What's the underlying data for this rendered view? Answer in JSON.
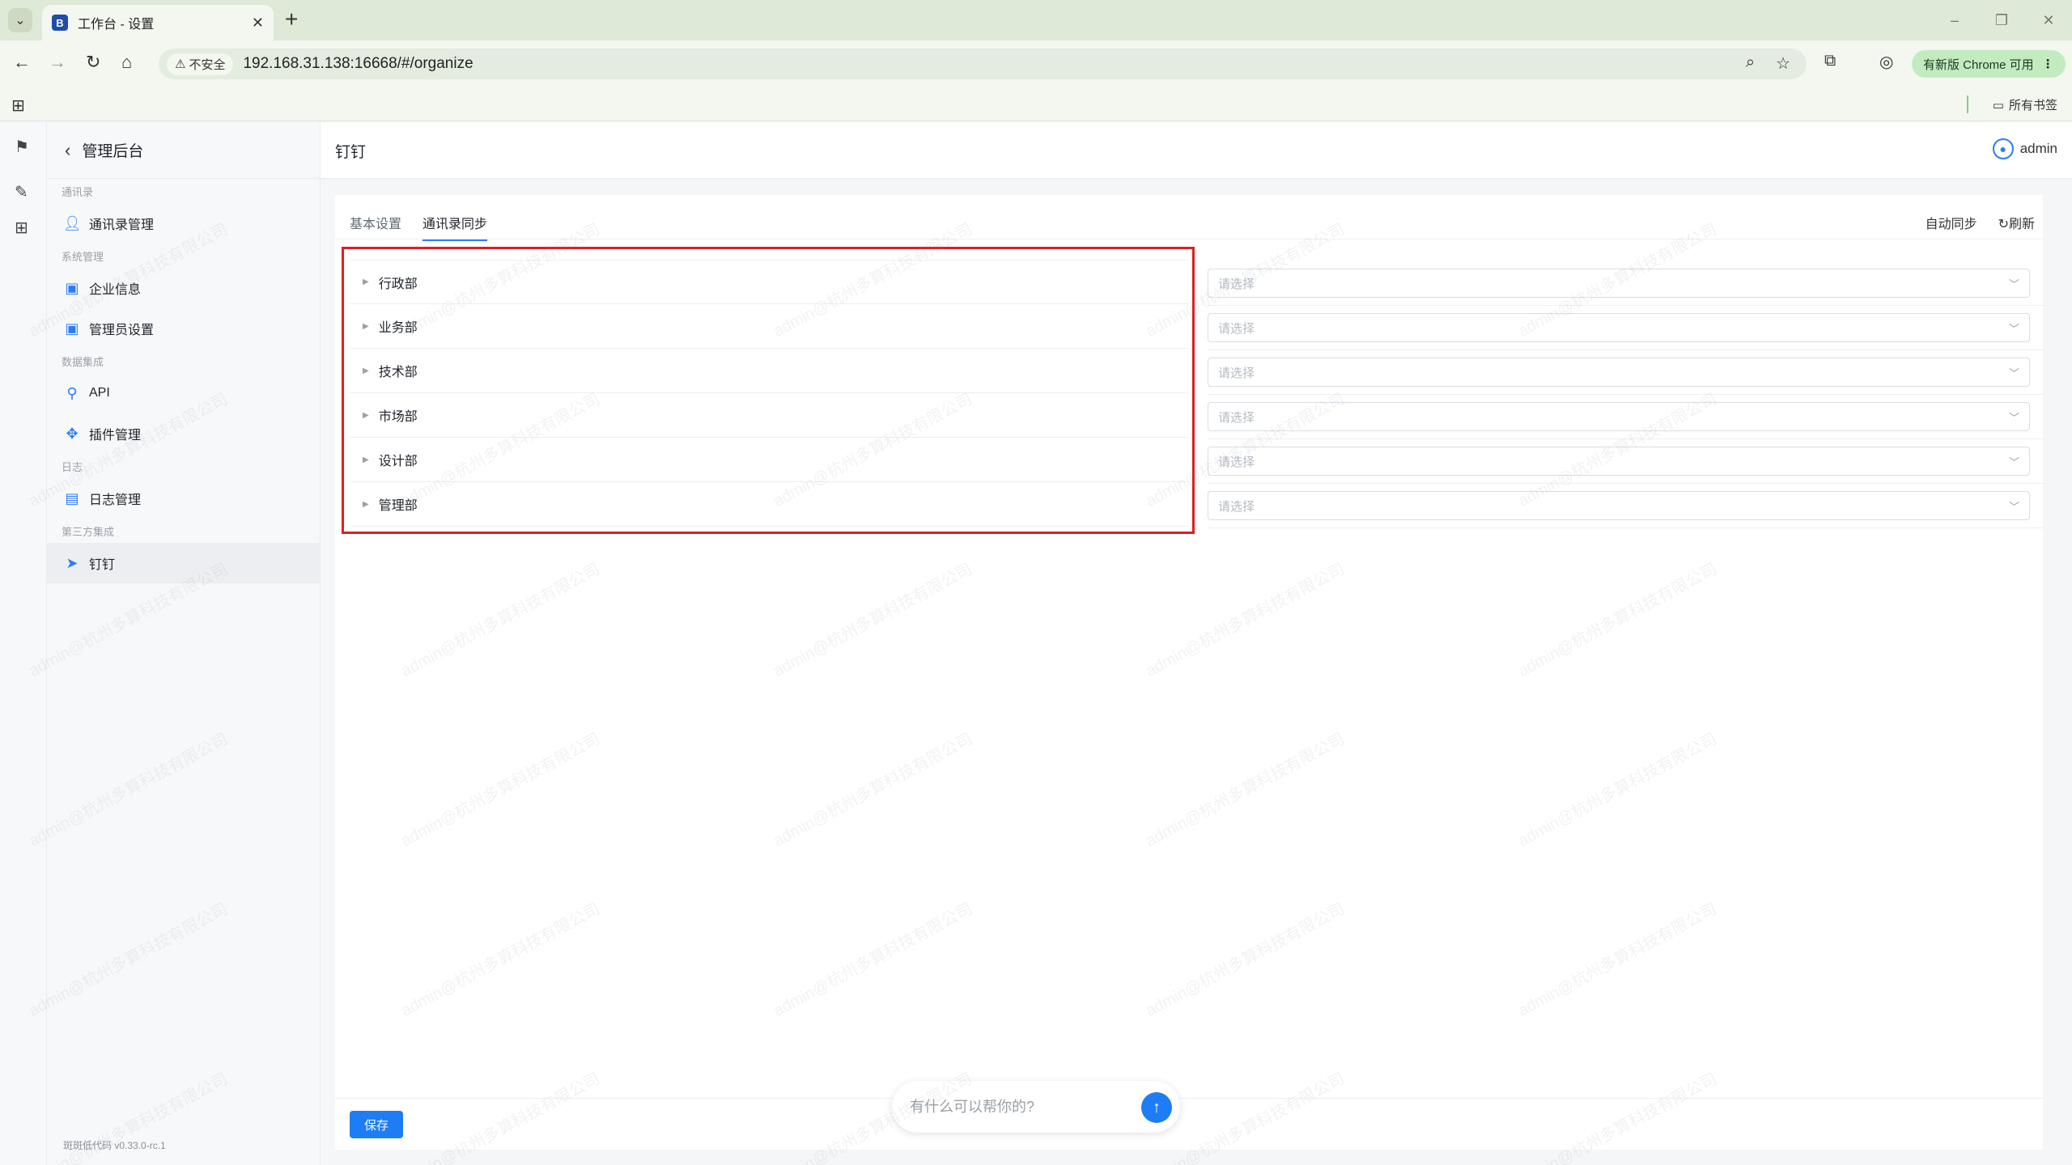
{
  "browser": {
    "tab_title": "工作台 - 设置",
    "insecure_label": "不安全",
    "url": "192.168.31.138:16668/#/organize",
    "update_label": "有新版 Chrome 可用",
    "all_bookmarks": "所有书签"
  },
  "sidebar": {
    "title": "管理后台",
    "groups": [
      {
        "label": "通讯录",
        "items": [
          {
            "label": "通讯录管理"
          }
        ]
      },
      {
        "label": "系统管理",
        "items": [
          {
            "label": "企业信息"
          },
          {
            "label": "管理员设置"
          }
        ]
      },
      {
        "label": "数据集成",
        "items": [
          {
            "label": "API"
          },
          {
            "label": "插件管理"
          }
        ]
      },
      {
        "label": "日志",
        "items": [
          {
            "label": "日志管理"
          }
        ]
      },
      {
        "label": "第三方集成",
        "items": [
          {
            "label": "钉钉"
          }
        ]
      }
    ],
    "version": "斑斑低代码 v0.33.0-rc.1"
  },
  "header": {
    "title": "钉钉",
    "user": "admin"
  },
  "tabs": [
    {
      "label": "基本设置"
    },
    {
      "label": "通讯录同步"
    }
  ],
  "actions": {
    "auto_sync": "自动同步",
    "refresh": "刷新"
  },
  "departments": [
    {
      "name": "行政部"
    },
    {
      "name": "业务部"
    },
    {
      "name": "技术部"
    },
    {
      "name": "市场部"
    },
    {
      "name": "设计部"
    },
    {
      "name": "管理部"
    }
  ],
  "select_placeholder": "请选择",
  "save_label": "保存",
  "assistant_placeholder": "有什么可以帮你的?",
  "watermark_text": "admin@杭州多算科技有限公司"
}
